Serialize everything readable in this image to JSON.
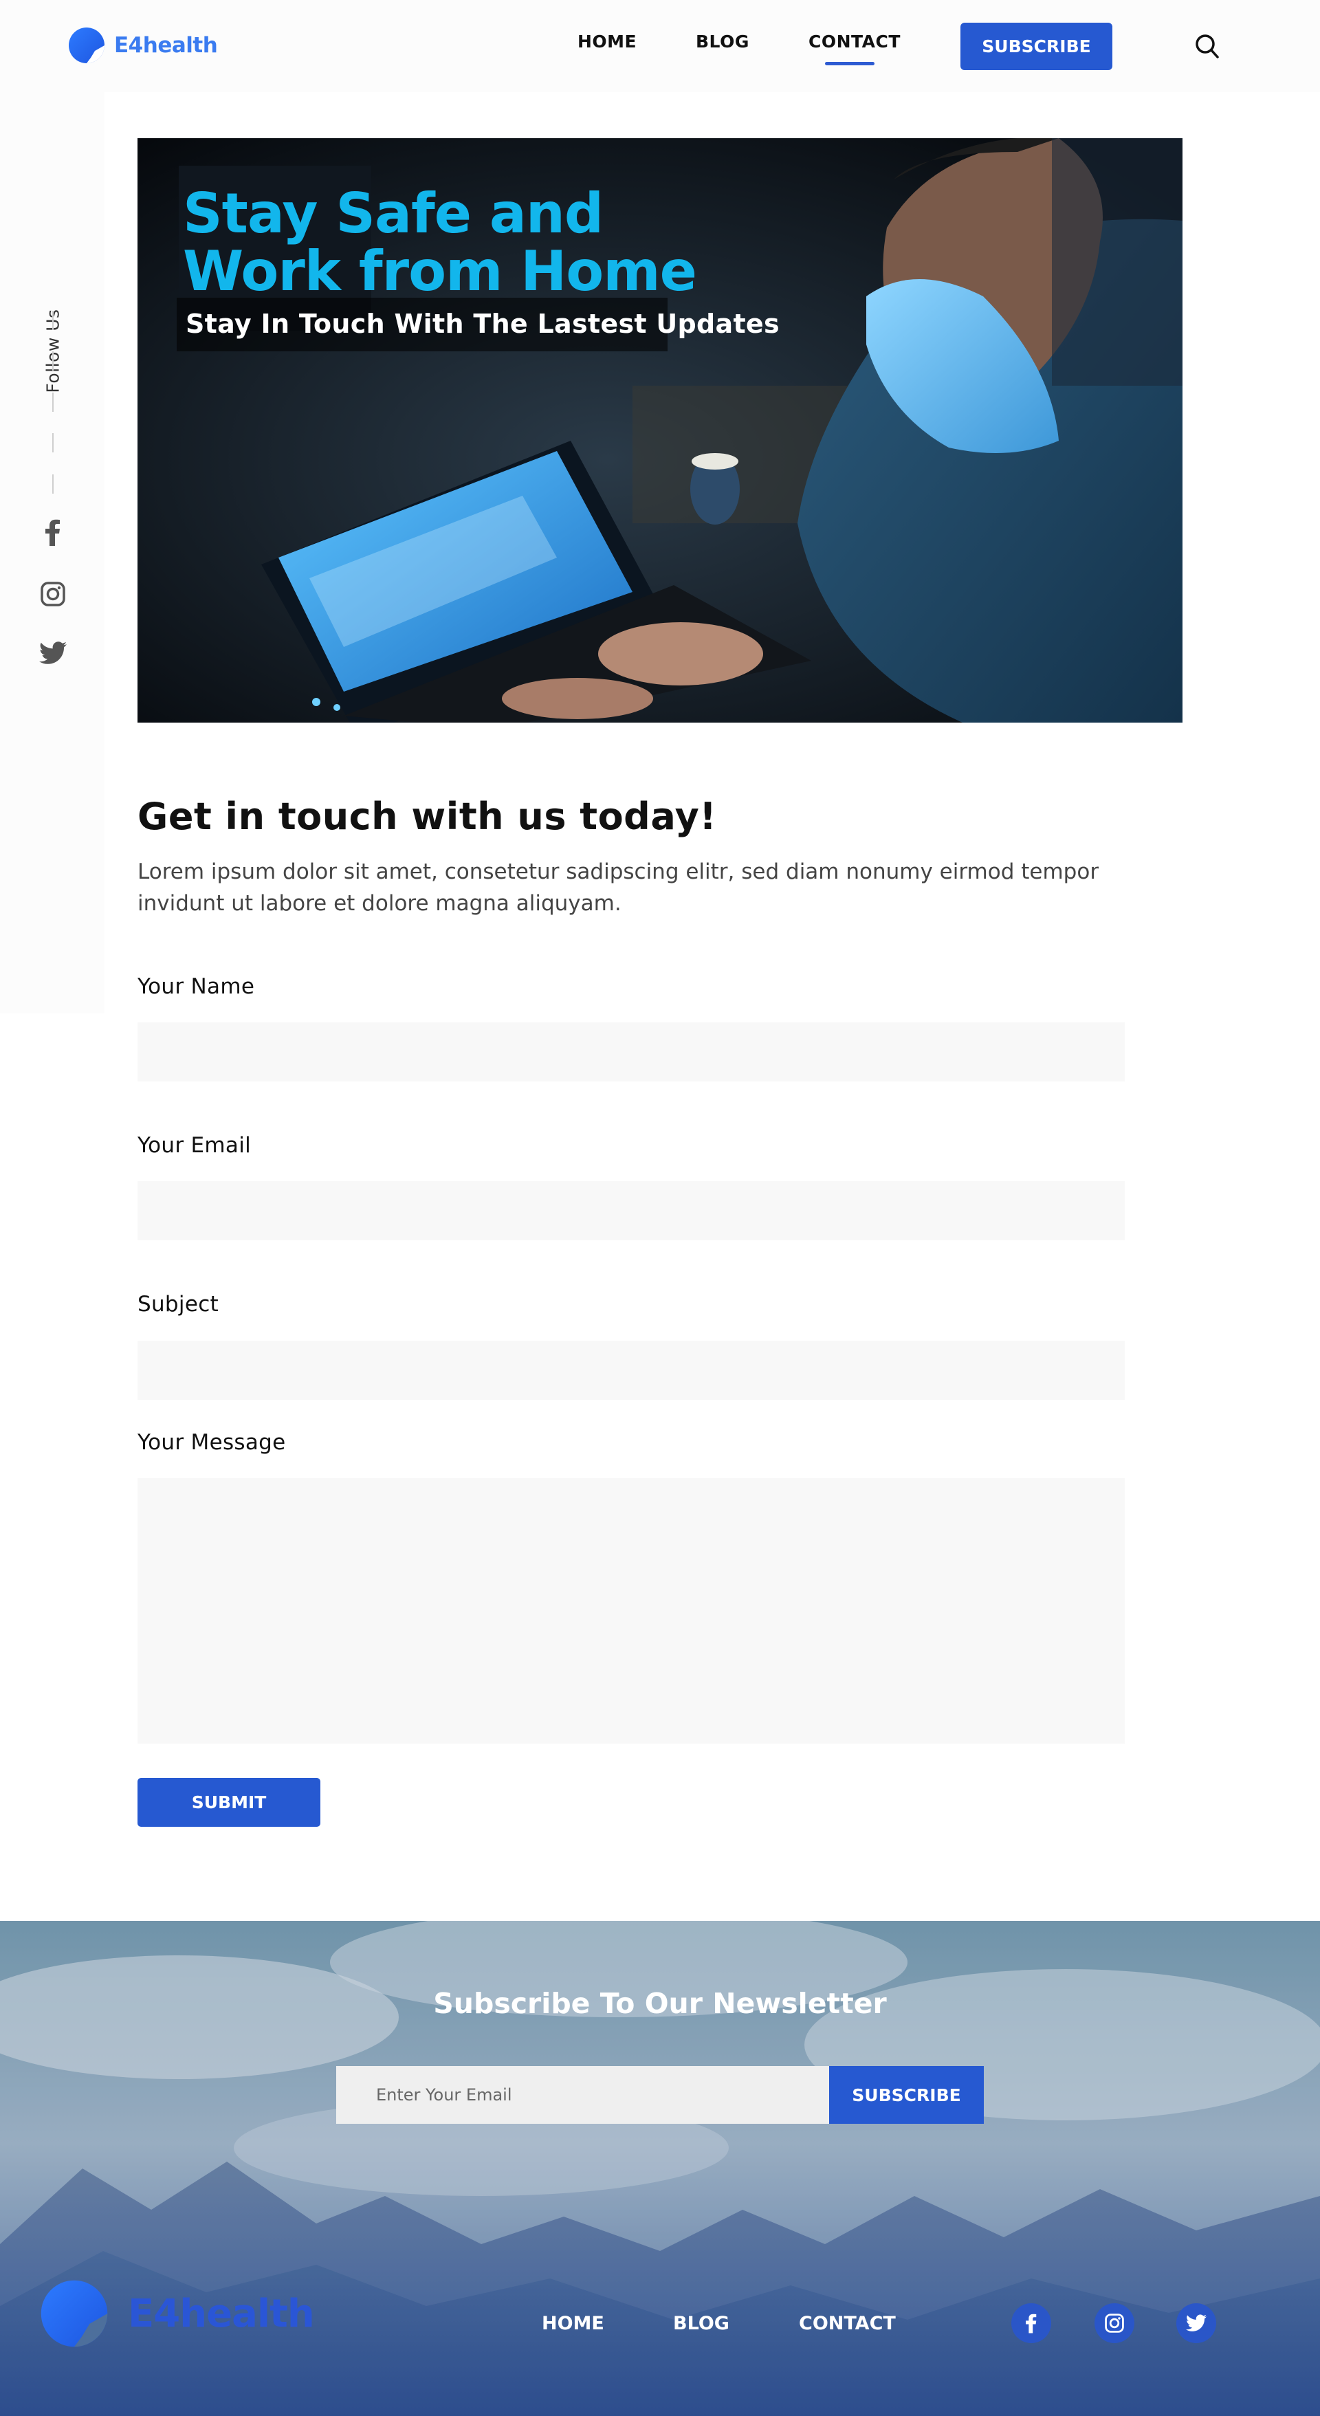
{
  "header": {
    "logo_text": "E4health",
    "nav": [
      "HOME",
      "BLOG",
      "CONTACT"
    ],
    "active_nav": "CONTACT",
    "subscribe_label": "SUBSCRIBE",
    "search_icon": "search-icon"
  },
  "side_rail": {
    "follow_label": "Follow Us",
    "social": [
      "facebook-icon",
      "instagram-icon",
      "twitter-icon"
    ]
  },
  "hero": {
    "title": "Stay Safe and\nWork from Home",
    "subtitle": "Stay In Touch With The Lastest Updates"
  },
  "contact": {
    "title": "Get in touch with us today!",
    "intro": "Lorem ipsum dolor sit amet, consetetur sadipscing elitr, sed diam nonumy eirmod tempor invidunt ut labore et dolore magna aliquyam.",
    "fields": {
      "name_label": "Your Name",
      "email_label": "Your Email",
      "subject_label": "Subject",
      "message_label": "Your Message",
      "name_value": "",
      "email_value": "",
      "subject_value": "",
      "message_value": ""
    },
    "submit_label": "SUBMIT"
  },
  "newsletter": {
    "title": "Subscribe To Our Newsletter",
    "email_placeholder": "Enter Your Email",
    "button_label": "SUBSCRIBE"
  },
  "footer": {
    "logo_text": "E4health",
    "nav": [
      "HOME",
      "BLOG",
      "CONTACT"
    ],
    "social": [
      "facebook-icon",
      "instagram-icon",
      "twitter-icon"
    ]
  },
  "colors": {
    "accent": "#2659d1",
    "hero_title": "#12b6ec",
    "logo_blue": "#3a7bf0"
  }
}
